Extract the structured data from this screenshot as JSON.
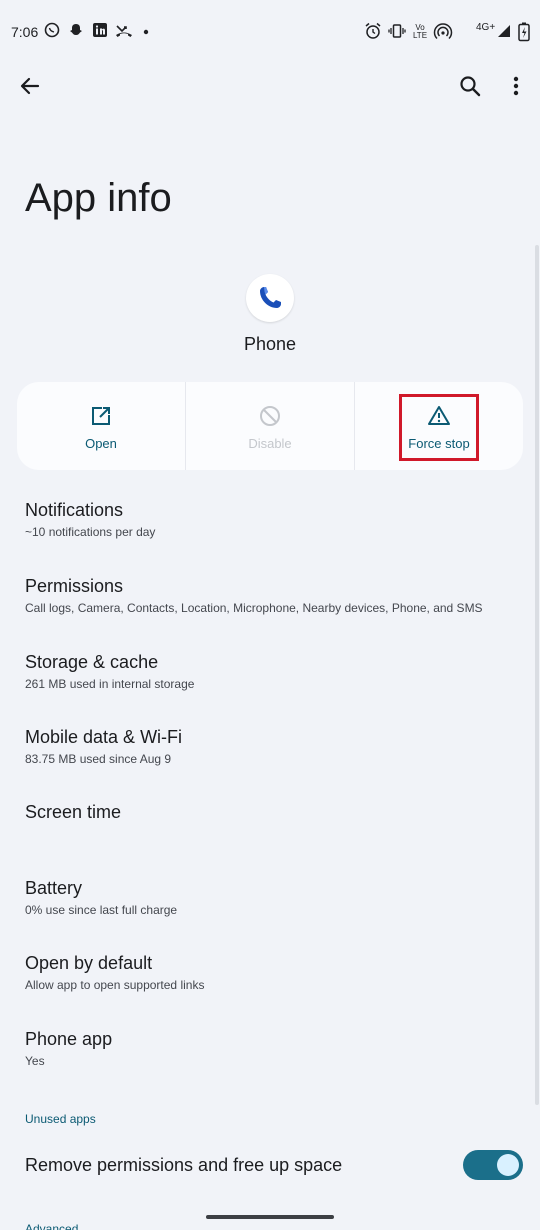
{
  "status_bar": {
    "time": "7:06",
    "network": "4G+",
    "lte_label": "Vo LTE"
  },
  "appbar": {
    "back_icon": "arrow-back-icon",
    "search_icon": "search-icon",
    "more_icon": "more-vert-icon"
  },
  "page": {
    "title": "App info"
  },
  "app": {
    "name": "Phone",
    "icon": "phone-handset-icon"
  },
  "actions": [
    {
      "label": "Open",
      "icon": "open-in-new-icon",
      "enabled": true
    },
    {
      "label": "Disable",
      "icon": "block-icon",
      "enabled": false
    },
    {
      "label": "Force stop",
      "icon": "warning-triangle-icon",
      "enabled": true
    }
  ],
  "settings": [
    {
      "title": "Notifications",
      "summary": "~10 notifications per day"
    },
    {
      "title": "Permissions",
      "summary": "Call logs, Camera, Contacts, Location, Microphone, Nearby devices, Phone, and SMS"
    },
    {
      "title": "Storage & cache",
      "summary": "261 MB used in internal storage"
    },
    {
      "title": "Mobile data & Wi-Fi",
      "summary": "83.75 MB used since Aug 9"
    },
    {
      "title": "Screen time",
      "summary": ""
    },
    {
      "title": "Battery",
      "summary": "0% use since last full charge"
    },
    {
      "title": "Open by default",
      "summary": "Allow app to open supported links"
    },
    {
      "title": "Phone app",
      "summary": "Yes"
    }
  ],
  "unused_apps": {
    "header": "Unused apps",
    "toggle_label": "Remove permissions and free up space",
    "toggle_on": true
  },
  "advanced": {
    "header": "Advanced"
  },
  "colors": {
    "accent": "#0b5a73",
    "background": "#f1f3f8",
    "highlight": "#d0192a",
    "switch_track": "#1b6f8a"
  }
}
